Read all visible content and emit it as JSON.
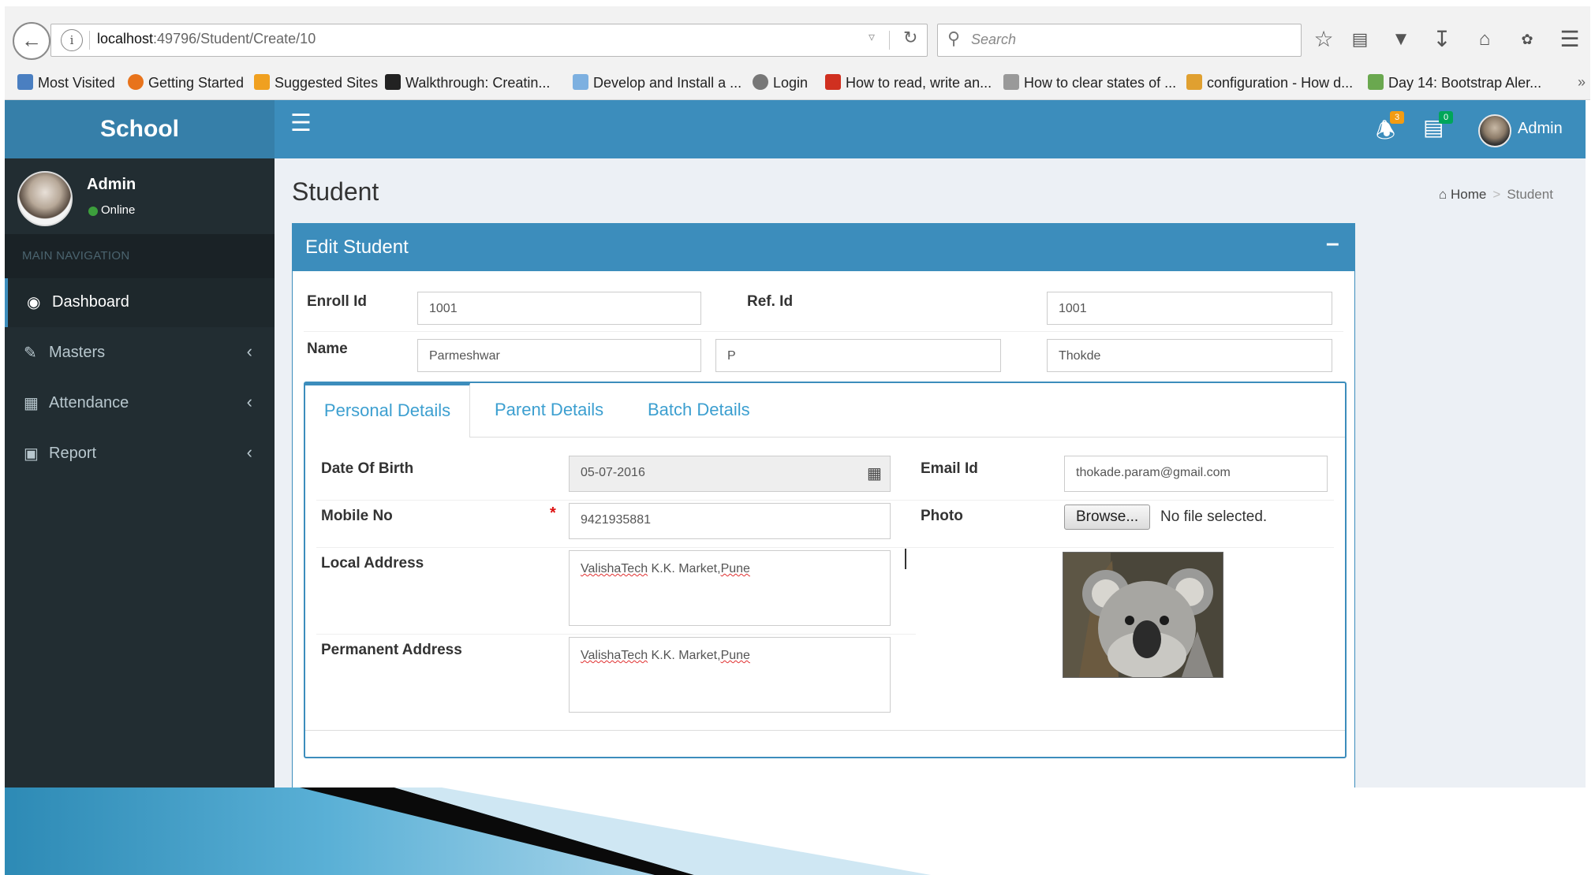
{
  "browser": {
    "url_host": "localhost",
    "url_path": ":49796/Student/Create/10",
    "search_placeholder": "Search",
    "bookmarks": [
      {
        "label": "Most Visited",
        "color": "#4a7fc1"
      },
      {
        "label": "Getting Started",
        "color": "#e8731b"
      },
      {
        "label": "Suggested Sites",
        "color": "#f0a020"
      },
      {
        "label": "Walkthrough: Creatin...",
        "color": "#222222"
      },
      {
        "label": "Develop and Install a ...",
        "color": "#7db0e0"
      },
      {
        "label": "Login",
        "color": "#777777"
      },
      {
        "label": "How to read, write an...",
        "color": "#d03020"
      },
      {
        "label": "How to clear states of ...",
        "color": "#999999"
      },
      {
        "label": "configuration - How d...",
        "color": "#e0a030"
      },
      {
        "label": "Day 14: Bootstrap Aler...",
        "color": "#6aa84f"
      }
    ]
  },
  "app": {
    "brand": "School",
    "header": {
      "notifications_count": "3",
      "tasks_count": "0",
      "user_name": "Admin",
      "badge_warning_color": "#f39c12",
      "badge_success_color": "#00a65a"
    },
    "sidebar": {
      "user_name": "Admin",
      "status": "Online",
      "nav_header": "MAIN NAVIGATION",
      "items": [
        {
          "label": "Dashboard",
          "icon": "dashboard-icon"
        },
        {
          "label": "Masters",
          "icon": "edit-icon"
        },
        {
          "label": "Attendance",
          "icon": "grid-icon"
        },
        {
          "label": "Report",
          "icon": "table-icon"
        }
      ]
    }
  },
  "page": {
    "title": "Student",
    "breadcrumb_home": "Home",
    "breadcrumb_current": "Student",
    "box_title": "Edit Student",
    "form": {
      "enroll_label": "Enroll Id",
      "enroll_value": "1001",
      "ref_label": "Ref. Id",
      "ref_value": "1001",
      "name_label": "Name",
      "first_name": "Parmeshwar",
      "middle_name": "P",
      "last_name": "Thokde"
    },
    "tabs": [
      "Personal Details",
      "Parent Details",
      "Batch Details"
    ],
    "personal": {
      "dob_label": "Date Of Birth",
      "dob_value": "05-07-2016",
      "email_label": "Email Id",
      "email_value": "thokade.param@gmail.com",
      "mobile_label": "Mobile No",
      "mobile_value": "9421935881",
      "photo_label": "Photo",
      "browse_label": "Browse...",
      "file_status": "No file selected.",
      "local_label": "Local Address",
      "local_value": {
        "a": "ValishaTech",
        "b": " K.K. Market,",
        "c": "Pune"
      },
      "perm_label": "Permanent Address",
      "perm_value": {
        "a": "ValishaTech",
        "b": " K.K. Market,",
        "c": "Pune"
      }
    }
  },
  "colors": {
    "header_blue": "#3c8dbc",
    "logo_blue": "#367fa9",
    "sidebar_dark": "#222d32",
    "content_bg": "#ecf0f5"
  }
}
